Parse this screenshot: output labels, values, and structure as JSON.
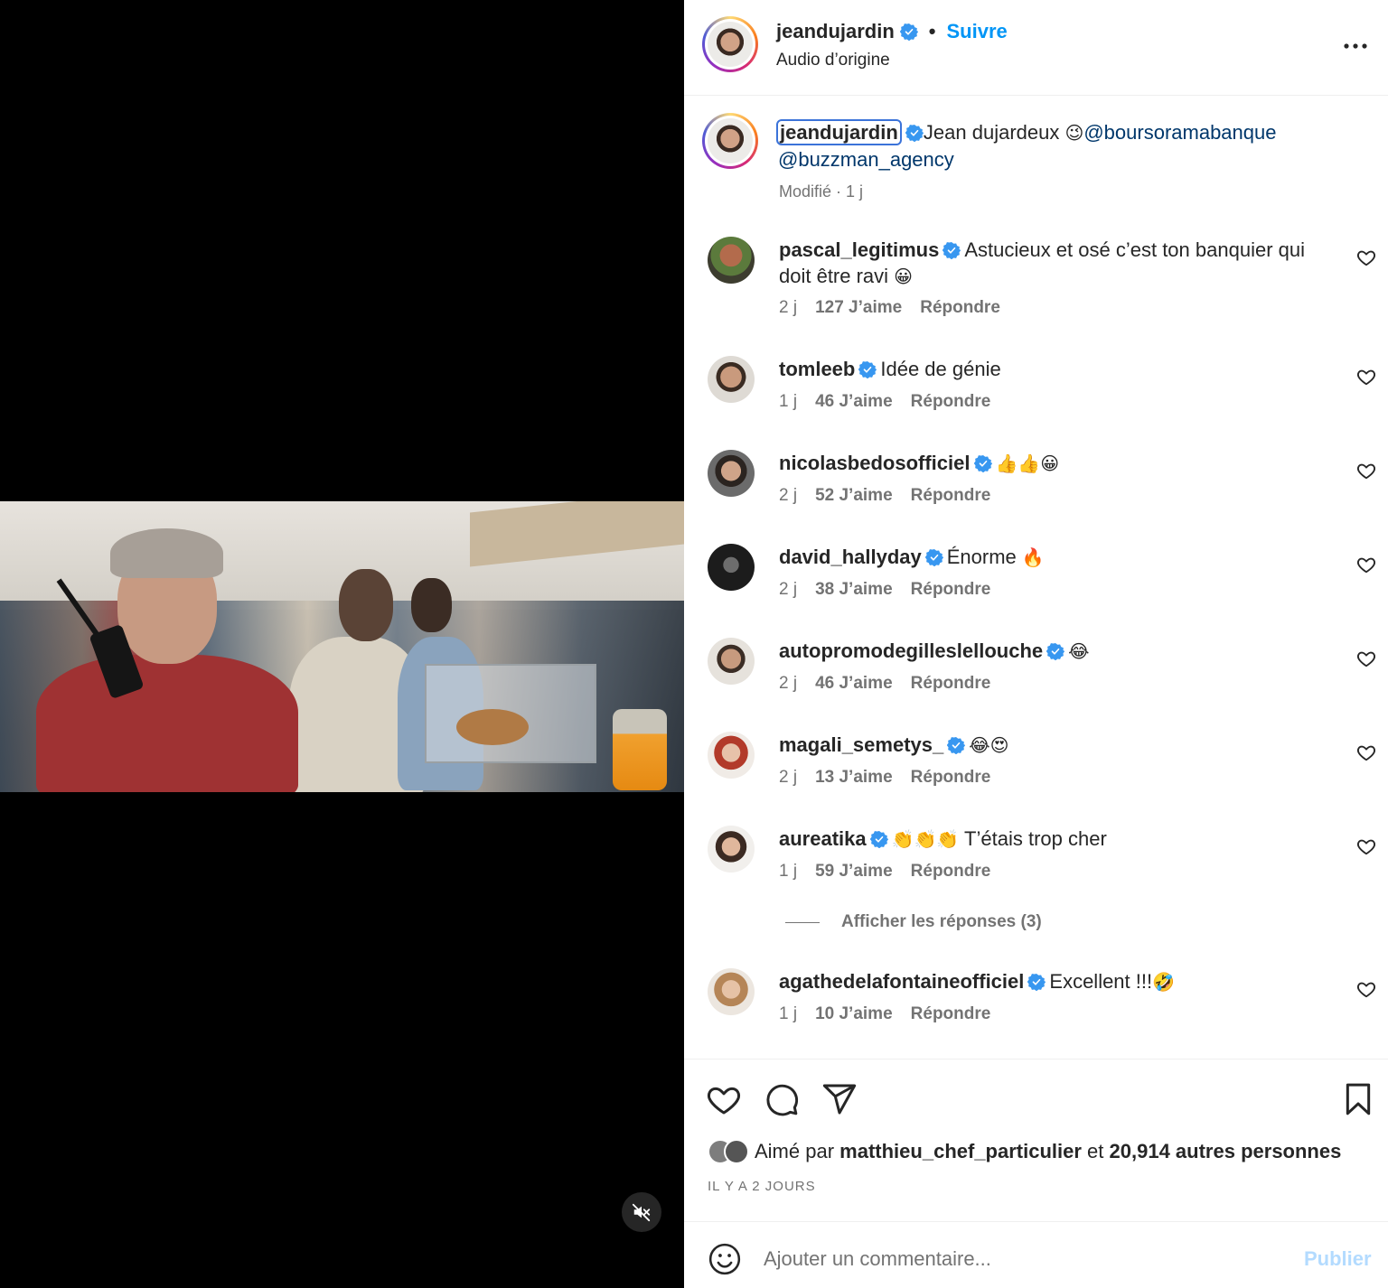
{
  "header": {
    "username": "jeandujardin",
    "separator": "•",
    "follow_label": "Suivre",
    "audio": "Audio d’origine"
  },
  "caption": {
    "username": "jeandujardin",
    "text": "Jean dujardeux ",
    "emoji": "😉",
    "mention1": "@boursoramabanque",
    "mention2": "@buzzman_agency",
    "meta": "Modifié · 1 j"
  },
  "comments": [
    {
      "username": "pascal_legitimus",
      "text": "Astucieux et osé c’est ton banquier qui doit être ravi ",
      "emoji": "😀",
      "time": "2 j",
      "likes": "127 J’aime",
      "reply": "Répondre"
    },
    {
      "username": "tomleeb",
      "text": "Idée de génie",
      "emoji": "",
      "time": "1 j",
      "likes": "46 J’aime",
      "reply": "Répondre"
    },
    {
      "username": "nicolasbedosofficiel",
      "text": "",
      "emoji": "👍👍😀",
      "time": "2 j",
      "likes": "52 J’aime",
      "reply": "Répondre"
    },
    {
      "username": "david_hallyday",
      "text": "Énorme ",
      "emoji": "🔥",
      "time": "2 j",
      "likes": "38 J’aime",
      "reply": "Répondre"
    },
    {
      "username": "autopromodegilleslellouche",
      "text": "",
      "emoji": "😂",
      "time": "2 j",
      "likes": "46 J’aime",
      "reply": "Répondre"
    },
    {
      "username": "magali_semetys_",
      "text": "",
      "emoji": "😂😍",
      "time": "2 j",
      "likes": "13 J’aime",
      "reply": "Répondre"
    },
    {
      "username": "aureatika",
      "text": " T’étais trop cher",
      "emoji": "👏👏👏",
      "time": "1 j",
      "likes": "59 J’aime",
      "reply": "Répondre"
    },
    {
      "username": "agathedelafontaineofficiel",
      "text": "Excellent !!!",
      "emoji": "🤣",
      "time": "1 j",
      "likes": "10 J’aime",
      "reply": "Répondre"
    }
  ],
  "view_replies": "Afficher les réponses (3)",
  "likes": {
    "prefix": "Aimé par",
    "user": "matthieu_chef_particulier",
    "middle": "et",
    "count": "20,914 autres personnes"
  },
  "timestamp": "IL Y A 2 JOURS",
  "add_comment": {
    "placeholder": "Ajouter un commentaire...",
    "publish": "Publier"
  },
  "colors": {
    "accent": "#0095f6",
    "verified": "#3897f0",
    "publish_disabled": "#b3dbff",
    "mention": "#00376b"
  }
}
